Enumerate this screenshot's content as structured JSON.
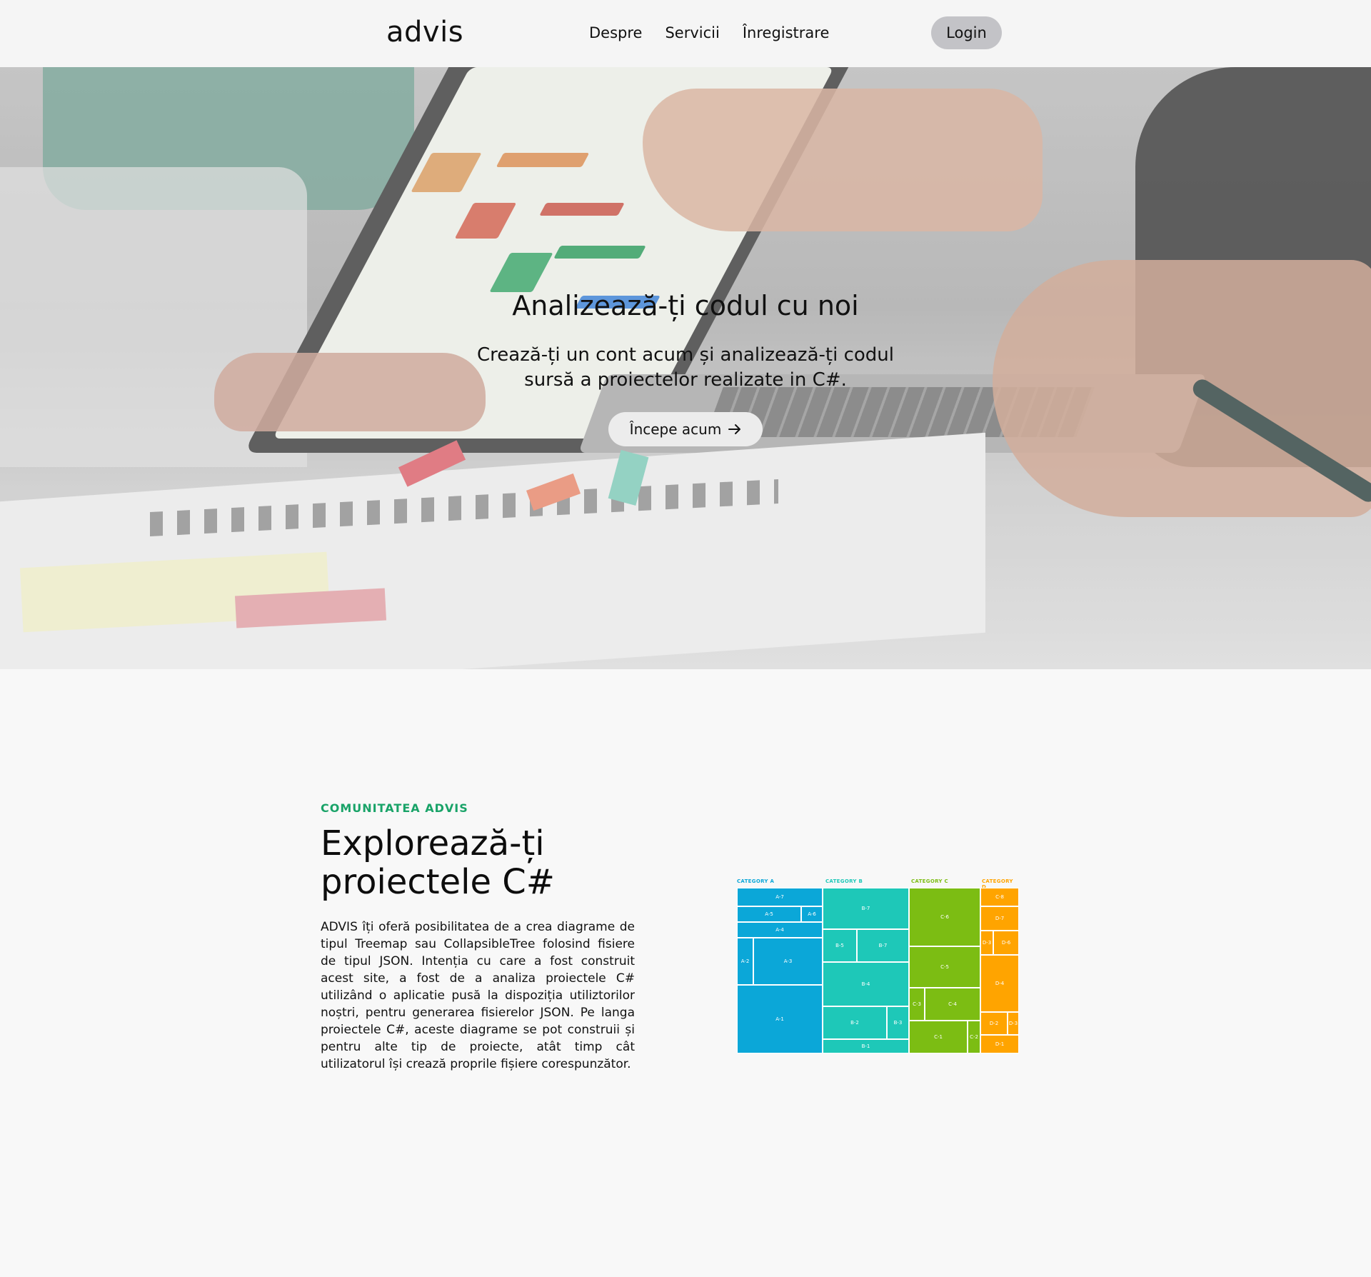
{
  "header": {
    "logo": "advis",
    "nav": [
      "Despre",
      "Servicii",
      "Înregistrare"
    ],
    "login_label": "Login"
  },
  "hero": {
    "title": "Analizează-ți codul cu noi",
    "subtitle": "Crează-ți un cont acum și analizează-ți codul sursă a proiectelor realizate in C#.",
    "cta_label": "Începe acum",
    "cta_icon": "arrow-right-icon"
  },
  "about": {
    "eyebrow": "COMUNITATEA ADVIS",
    "title": "Explorează-ți proiectele C#",
    "text": "ADVIS îți oferă posibilitatea de a crea diagrame de tipul Treemap sau CollapsibleTree folosind fisiere de tipul JSON. Intenția cu care a fost construit acest site, a fost de a analiza proiectele C# utilizând o aplicatie pusă la dispoziția utiliztorilor noștri, pentru generarea fisierelor JSON. Pe langa proiectele C#, aceste diagrame se pot construii și pentru alte tip de proiecte, atât timp cât utilizatorul își crează proprile fișiere corespunzător."
  },
  "treemap": {
    "categories": [
      {
        "name": "CATEGORY A",
        "color": "#0ba7d8",
        "label_color": "#0ba7d8",
        "tiles": [
          "A-7",
          "A-5",
          "A-6",
          "A-4",
          "A-2",
          "A-3",
          "A-1"
        ]
      },
      {
        "name": "CATEGORY B",
        "color": "#1ec8b8",
        "label_color": "#1ec8b8",
        "tiles": [
          "B-7",
          "B-5",
          "B-7",
          "B-4",
          "B-2",
          "B-3",
          "B-1"
        ]
      },
      {
        "name": "CATEGORY C",
        "color": "#7cbd13",
        "label_color": "#7cbd13",
        "tiles": [
          "C-6",
          "C-5",
          "C-3",
          "C-4",
          "C-1",
          "C-2"
        ]
      },
      {
        "name": "CATEGORY D",
        "color": "#ffa400",
        "label_color": "#ffa400",
        "tiles": [
          "C-8",
          "D-7",
          "D-3",
          "D-6",
          "D-4",
          "D-2",
          "D-3",
          "D-1"
        ]
      }
    ]
  }
}
